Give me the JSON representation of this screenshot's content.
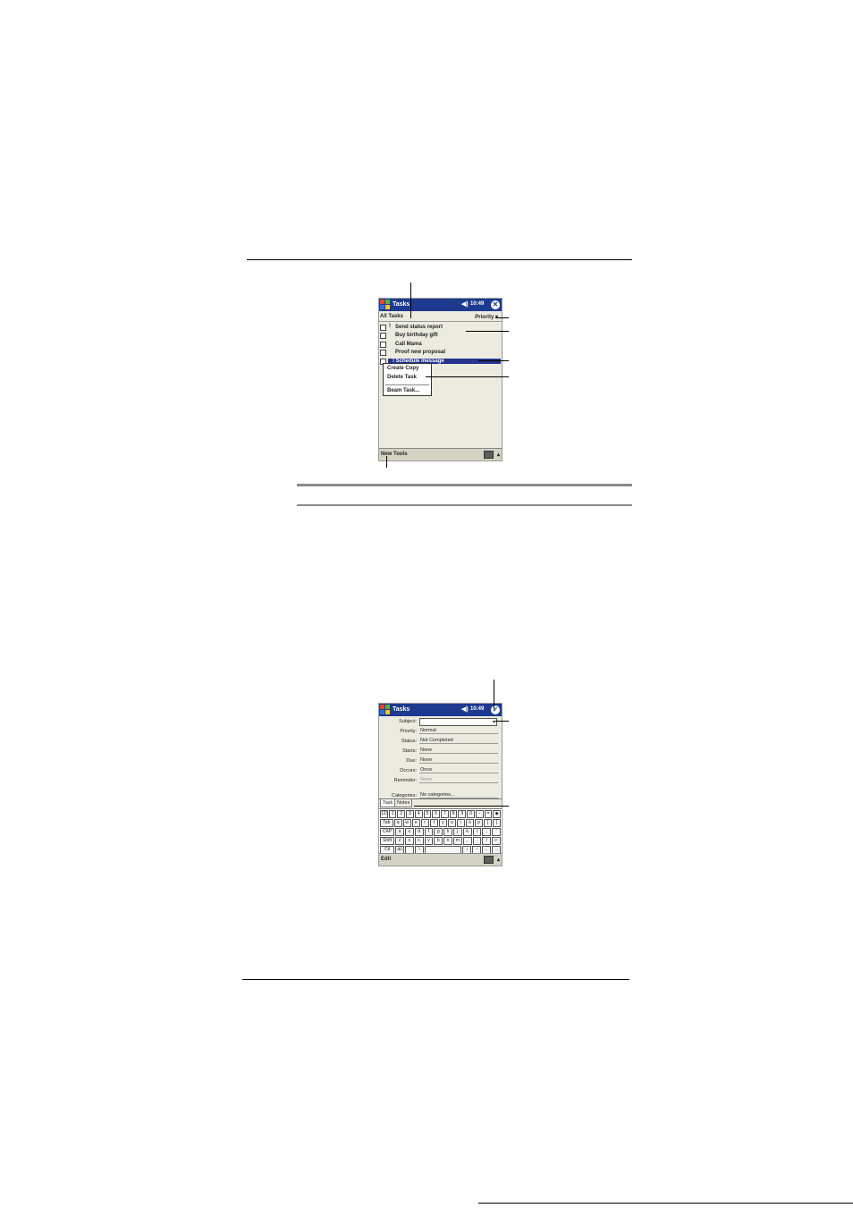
{
  "tasks_screen": {
    "title": "Tasks",
    "time": "10:49",
    "filter_label": "All Tasks",
    "sort_label": "Priority",
    "tasks": [
      {
        "priority": "!",
        "label": "Send status report",
        "selected": false
      },
      {
        "priority": "",
        "label": "Buy birthday gift",
        "selected": false
      },
      {
        "priority": "",
        "label": "Call Mama",
        "selected": false
      },
      {
        "priority": "",
        "label": "Proof new proposal",
        "selected": false
      },
      {
        "priority": "!",
        "label": "Schedule message",
        "selected": true
      }
    ],
    "context_menu": [
      "Create Copy",
      "Delete Task",
      "Beam Task..."
    ],
    "menu_bar_label": "New Tools"
  },
  "task_form_screen": {
    "title": "Tasks",
    "time": "10:49",
    "fields": [
      {
        "label": "Subject:",
        "value": ""
      },
      {
        "label": "Priority:",
        "value": "Normal"
      },
      {
        "label": "Status:",
        "value": "Not Completed"
      },
      {
        "label": "Starts:",
        "value": "None"
      },
      {
        "label": "Due:",
        "value": "None"
      },
      {
        "label": "Occurs:",
        "value": "Once"
      },
      {
        "label": "Reminder:",
        "value": "None"
      },
      {
        "label": "Categories:",
        "value": "No categories..."
      }
    ],
    "tabs": [
      "Task",
      "Notes"
    ],
    "keyboard_rows": [
      [
        "123",
        "1",
        "2",
        "3",
        "4",
        "5",
        "6",
        "7",
        "8",
        "9",
        "0",
        "-",
        "=",
        "◆"
      ],
      [
        "Tab",
        "q",
        "w",
        "e",
        "r",
        "t",
        "y",
        "u",
        "i",
        "o",
        "p",
        "[",
        "]"
      ],
      [
        "CAP",
        "a",
        "s",
        "d",
        "f",
        "g",
        "h",
        "j",
        "k",
        "l",
        ";",
        "'"
      ],
      [
        "Shift",
        "z",
        "x",
        "c",
        "v",
        "b",
        "n",
        "m",
        ",",
        ".",
        "/",
        "↵"
      ],
      [
        "Ctl",
        "áü",
        "`",
        "\\",
        " ",
        "↓",
        "↑",
        "←",
        "→"
      ]
    ],
    "menu_bar_label": "Edit"
  }
}
